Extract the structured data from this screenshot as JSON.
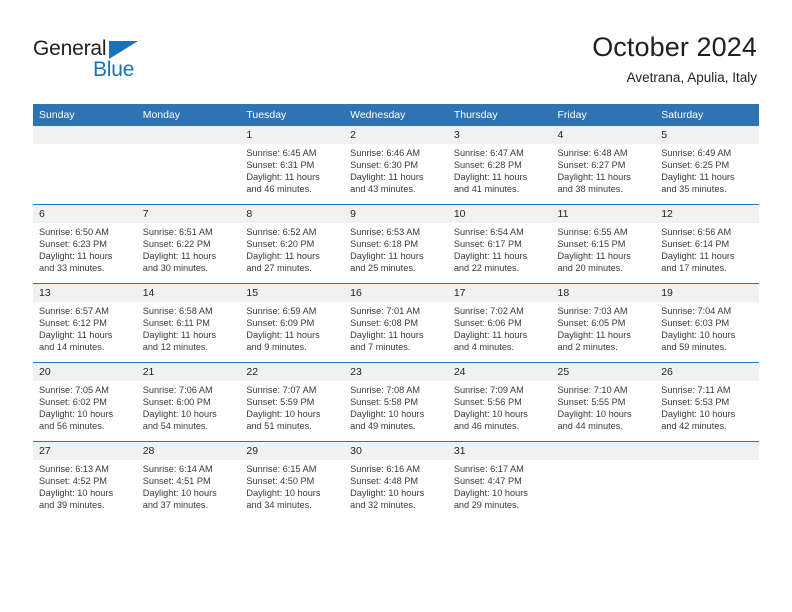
{
  "logo": {
    "word_top": "General",
    "word_bottom": "Blue",
    "triangle_icon": "triangle-icon",
    "color_dark": "#231f20",
    "color_blue": "#1b72b8"
  },
  "header": {
    "title": "October 2024",
    "subtitle": "Avetrana, Apulia, Italy"
  },
  "theme": {
    "header_blue": "#2e74b5",
    "daynum_gray": "#f1f1f1",
    "text": "#231f20"
  },
  "weekdays": [
    "Sunday",
    "Monday",
    "Tuesday",
    "Wednesday",
    "Thursday",
    "Friday",
    "Saturday"
  ],
  "weeks": [
    [
      {
        "day": "",
        "lines": []
      },
      {
        "day": "",
        "lines": []
      },
      {
        "day": "1",
        "lines": [
          "Sunrise: 6:45 AM",
          "Sunset: 6:31 PM",
          "Daylight: 11 hours",
          "and 46 minutes."
        ]
      },
      {
        "day": "2",
        "lines": [
          "Sunrise: 6:46 AM",
          "Sunset: 6:30 PM",
          "Daylight: 11 hours",
          "and 43 minutes."
        ]
      },
      {
        "day": "3",
        "lines": [
          "Sunrise: 6:47 AM",
          "Sunset: 6:28 PM",
          "Daylight: 11 hours",
          "and 41 minutes."
        ]
      },
      {
        "day": "4",
        "lines": [
          "Sunrise: 6:48 AM",
          "Sunset: 6:27 PM",
          "Daylight: 11 hours",
          "and 38 minutes."
        ]
      },
      {
        "day": "5",
        "lines": [
          "Sunrise: 6:49 AM",
          "Sunset: 6:25 PM",
          "Daylight: 11 hours",
          "and 35 minutes."
        ]
      }
    ],
    [
      {
        "day": "6",
        "lines": [
          "Sunrise: 6:50 AM",
          "Sunset: 6:23 PM",
          "Daylight: 11 hours",
          "and 33 minutes."
        ]
      },
      {
        "day": "7",
        "lines": [
          "Sunrise: 6:51 AM",
          "Sunset: 6:22 PM",
          "Daylight: 11 hours",
          "and 30 minutes."
        ]
      },
      {
        "day": "8",
        "lines": [
          "Sunrise: 6:52 AM",
          "Sunset: 6:20 PM",
          "Daylight: 11 hours",
          "and 27 minutes."
        ]
      },
      {
        "day": "9",
        "lines": [
          "Sunrise: 6:53 AM",
          "Sunset: 6:18 PM",
          "Daylight: 11 hours",
          "and 25 minutes."
        ]
      },
      {
        "day": "10",
        "lines": [
          "Sunrise: 6:54 AM",
          "Sunset: 6:17 PM",
          "Daylight: 11 hours",
          "and 22 minutes."
        ]
      },
      {
        "day": "11",
        "lines": [
          "Sunrise: 6:55 AM",
          "Sunset: 6:15 PM",
          "Daylight: 11 hours",
          "and 20 minutes."
        ]
      },
      {
        "day": "12",
        "lines": [
          "Sunrise: 6:56 AM",
          "Sunset: 6:14 PM",
          "Daylight: 11 hours",
          "and 17 minutes."
        ]
      }
    ],
    [
      {
        "day": "13",
        "lines": [
          "Sunrise: 6:57 AM",
          "Sunset: 6:12 PM",
          "Daylight: 11 hours",
          "and 14 minutes."
        ]
      },
      {
        "day": "14",
        "lines": [
          "Sunrise: 6:58 AM",
          "Sunset: 6:11 PM",
          "Daylight: 11 hours",
          "and 12 minutes."
        ]
      },
      {
        "day": "15",
        "lines": [
          "Sunrise: 6:59 AM",
          "Sunset: 6:09 PM",
          "Daylight: 11 hours",
          "and 9 minutes."
        ]
      },
      {
        "day": "16",
        "lines": [
          "Sunrise: 7:01 AM",
          "Sunset: 6:08 PM",
          "Daylight: 11 hours",
          "and 7 minutes."
        ]
      },
      {
        "day": "17",
        "lines": [
          "Sunrise: 7:02 AM",
          "Sunset: 6:06 PM",
          "Daylight: 11 hours",
          "and 4 minutes."
        ]
      },
      {
        "day": "18",
        "lines": [
          "Sunrise: 7:03 AM",
          "Sunset: 6:05 PM",
          "Daylight: 11 hours",
          "and 2 minutes."
        ]
      },
      {
        "day": "19",
        "lines": [
          "Sunrise: 7:04 AM",
          "Sunset: 6:03 PM",
          "Daylight: 10 hours",
          "and 59 minutes."
        ]
      }
    ],
    [
      {
        "day": "20",
        "lines": [
          "Sunrise: 7:05 AM",
          "Sunset: 6:02 PM",
          "Daylight: 10 hours",
          "and 56 minutes."
        ]
      },
      {
        "day": "21",
        "lines": [
          "Sunrise: 7:06 AM",
          "Sunset: 6:00 PM",
          "Daylight: 10 hours",
          "and 54 minutes."
        ]
      },
      {
        "day": "22",
        "lines": [
          "Sunrise: 7:07 AM",
          "Sunset: 5:59 PM",
          "Daylight: 10 hours",
          "and 51 minutes."
        ]
      },
      {
        "day": "23",
        "lines": [
          "Sunrise: 7:08 AM",
          "Sunset: 5:58 PM",
          "Daylight: 10 hours",
          "and 49 minutes."
        ]
      },
      {
        "day": "24",
        "lines": [
          "Sunrise: 7:09 AM",
          "Sunset: 5:56 PM",
          "Daylight: 10 hours",
          "and 46 minutes."
        ]
      },
      {
        "day": "25",
        "lines": [
          "Sunrise: 7:10 AM",
          "Sunset: 5:55 PM",
          "Daylight: 10 hours",
          "and 44 minutes."
        ]
      },
      {
        "day": "26",
        "lines": [
          "Sunrise: 7:11 AM",
          "Sunset: 5:53 PM",
          "Daylight: 10 hours",
          "and 42 minutes."
        ]
      }
    ],
    [
      {
        "day": "27",
        "lines": [
          "Sunrise: 6:13 AM",
          "Sunset: 4:52 PM",
          "Daylight: 10 hours",
          "and 39 minutes."
        ]
      },
      {
        "day": "28",
        "lines": [
          "Sunrise: 6:14 AM",
          "Sunset: 4:51 PM",
          "Daylight: 10 hours",
          "and 37 minutes."
        ]
      },
      {
        "day": "29",
        "lines": [
          "Sunrise: 6:15 AM",
          "Sunset: 4:50 PM",
          "Daylight: 10 hours",
          "and 34 minutes."
        ]
      },
      {
        "day": "30",
        "lines": [
          "Sunrise: 6:16 AM",
          "Sunset: 4:48 PM",
          "Daylight: 10 hours",
          "and 32 minutes."
        ]
      },
      {
        "day": "31",
        "lines": [
          "Sunrise: 6:17 AM",
          "Sunset: 4:47 PM",
          "Daylight: 10 hours",
          "and 29 minutes."
        ]
      },
      {
        "day": "",
        "lines": []
      },
      {
        "day": "",
        "lines": []
      }
    ]
  ]
}
